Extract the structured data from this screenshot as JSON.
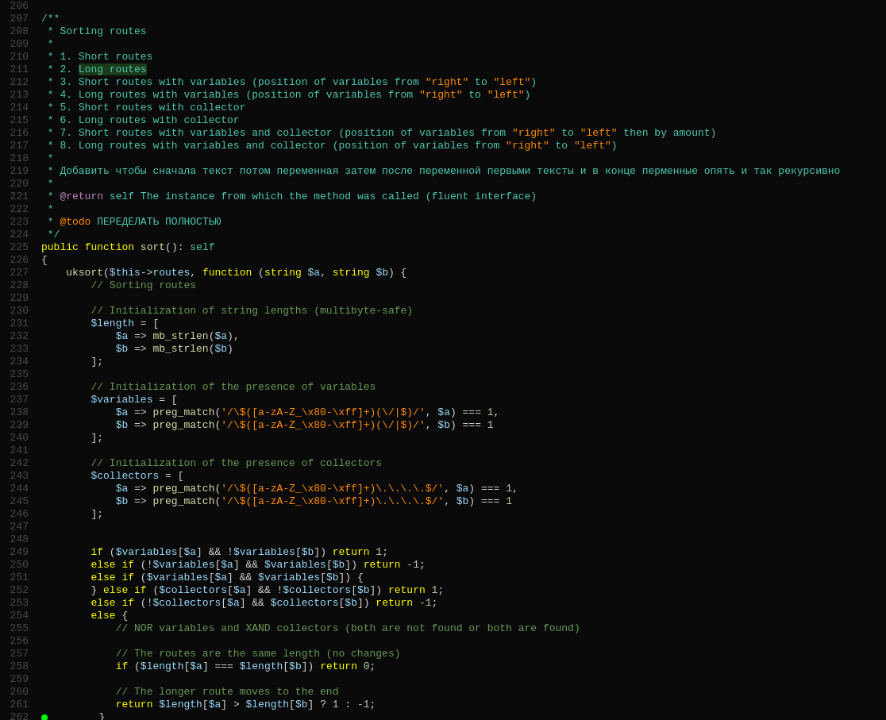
{
  "editor": {
    "lines": [
      {
        "num": "206",
        "content": "",
        "type": "blank"
      },
      {
        "num": "207",
        "content": "/**",
        "color": "c-comment"
      },
      {
        "num": "208",
        "content": " * Sorting routes",
        "color": "c-comment"
      },
      {
        "num": "209",
        "content": " *",
        "color": "c-comment"
      },
      {
        "num": "210",
        "content": " * 1. Short routes",
        "color": "c-comment"
      },
      {
        "num": "211",
        "content": " * 2. Long routes",
        "color": "c-comment",
        "highlight_text": "Long routes",
        "highlight_start": 7
      },
      {
        "num": "212",
        "content": " * 3. Short routes with variables (position of variables from \"right\" to \"left\")",
        "color": "c-comment"
      },
      {
        "num": "213",
        "content": " * 4. Long routes with variables (position of variables from \"right\" to \"left\")",
        "color": "c-comment"
      },
      {
        "num": "214",
        "content": " * 5. Short routes with collector",
        "color": "c-comment"
      },
      {
        "num": "215",
        "content": " * 6. Long routes with collector",
        "color": "c-comment"
      },
      {
        "num": "216",
        "content": " * 7. Short routes with variables and collector (position of variables from \"right\" to \"left\" then by amount)",
        "color": "c-comment"
      },
      {
        "num": "217",
        "content": " * 8. Long routes with variables and collector (position of variables from \"right\" to \"left\")",
        "color": "c-comment"
      },
      {
        "num": "218",
        "content": " *",
        "color": "c-comment"
      },
      {
        "num": "219",
        "content": " * Добавить чтобы сначала текст потом переменная затем после переменной первыми тексты и в конце перменные опять и так рекурсивно",
        "color": "c-comment"
      },
      {
        "num": "220",
        "content": " *",
        "color": "c-comment"
      },
      {
        "num": "221",
        "content": " * @return self The instance from which the method was called (fluent interface)",
        "color": "c-comment"
      },
      {
        "num": "222",
        "content": " *",
        "color": "c-comment"
      },
      {
        "num": "223",
        "content": " * @todo ПЕРЕДЕЛАТЬ ПОЛНОСТЬЮ",
        "color": "c-comment"
      },
      {
        "num": "224",
        "content": " */",
        "color": "c-comment"
      },
      {
        "num": "225",
        "content": "public function sort(): self",
        "mixed": true
      },
      {
        "num": "226",
        "content": "{",
        "color": "c-white"
      },
      {
        "num": "227",
        "content": "    uksort($this->routes, function (string $a, string $b) {",
        "mixed": true
      },
      {
        "num": "228",
        "content": "        // Sorting routes",
        "color": "c-green"
      },
      {
        "num": "229",
        "content": "",
        "type": "blank"
      },
      {
        "num": "230",
        "content": "        // Initialization of string lengths (multibyte-safe)",
        "color": "c-green"
      },
      {
        "num": "231",
        "content": "        $length = [",
        "mixed": true
      },
      {
        "num": "232",
        "content": "            $a => mb_strlen($a),",
        "mixed": true
      },
      {
        "num": "233",
        "content": "            $b => mb_strlen($b)",
        "mixed": true
      },
      {
        "num": "234",
        "content": "        ];",
        "color": "c-white"
      },
      {
        "num": "235",
        "content": "",
        "type": "blank"
      },
      {
        "num": "236",
        "content": "        // Initialization of the presence of variables",
        "color": "c-green"
      },
      {
        "num": "237",
        "content": "        $variables = [",
        "mixed": true
      },
      {
        "num": "238",
        "content": "            $a => preg_match('/\\$([a-zA-Z_\\x80-\\xff]+)(\\/|$)/', $a) === 1,",
        "mixed": true
      },
      {
        "num": "239",
        "content": "            $b => preg_match('/\\$([a-zA-Z_\\x80-\\xff]+)(\\/|$)/', $b) === 1",
        "mixed": true
      },
      {
        "num": "240",
        "content": "        ];",
        "color": "c-white"
      },
      {
        "num": "241",
        "content": "",
        "type": "blank"
      },
      {
        "num": "242",
        "content": "        // Initialization of the presence of collectors",
        "color": "c-green"
      },
      {
        "num": "243",
        "content": "        $collectors = [",
        "mixed": true
      },
      {
        "num": "244",
        "content": "            $a => preg_match('/\\$([a-zA-Z_\\x80-\\xff]+)\\.\\.\\.\\.$/', $a) === 1,",
        "mixed": true
      },
      {
        "num": "245",
        "content": "            $b => preg_match('/\\$([a-zA-Z_\\x80-\\xff]+)\\.\\.\\.\\.$/', $b) === 1",
        "mixed": true
      },
      {
        "num": "246",
        "content": "        ];",
        "color": "c-white"
      },
      {
        "num": "247",
        "content": "",
        "type": "blank"
      },
      {
        "num": "248",
        "content": "",
        "type": "blank"
      },
      {
        "num": "249",
        "content": "        if ($variables[$a] && !$variables[$b]) return 1;",
        "mixed": true
      },
      {
        "num": "250",
        "content": "        else if (!$variables[$a] && $variables[$b]) return -1;",
        "mixed": true
      },
      {
        "num": "251",
        "content": "        else if ($variables[$a] && $variables[$b]) {",
        "mixed": true
      },
      {
        "num": "252",
        "content": "        } else if ($collectors[$a] && !$collectors[$b]) return 1;",
        "mixed": true
      },
      {
        "num": "253",
        "content": "        else if (!$collectors[$a] && $collectors[$b]) return -1;",
        "mixed": true
      },
      {
        "num": "254",
        "content": "        else {",
        "mixed": true
      },
      {
        "num": "255",
        "content": "            // NOR variables and XAND collectors (both are not found or both are found)",
        "color": "c-green"
      },
      {
        "num": "256",
        "content": "",
        "type": "blank"
      },
      {
        "num": "257",
        "content": "            // The routes are the same length (no changes)",
        "color": "c-green"
      },
      {
        "num": "258",
        "content": "            if ($length[$a] === $length[$b]) return 0;",
        "mixed": true
      },
      {
        "num": "259",
        "content": "",
        "type": "blank"
      },
      {
        "num": "260",
        "content": "            // The longer route moves to the end",
        "color": "c-green"
      },
      {
        "num": "261",
        "content": "            return $length[$a] > $length[$b] ? 1 : -1;",
        "mixed": true
      },
      {
        "num": "262",
        "content": "        }",
        "color": "c-white",
        "has_dot": true
      }
    ]
  }
}
